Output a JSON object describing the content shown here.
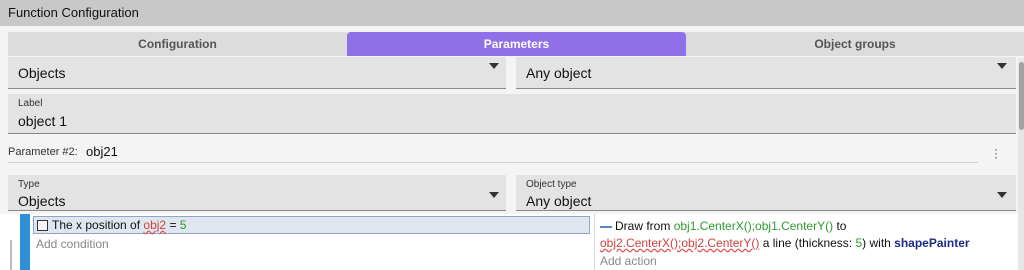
{
  "titlebar": {
    "title": "Function Configuration"
  },
  "tabs": [
    {
      "label": "Configuration"
    },
    {
      "label": "Parameters"
    },
    {
      "label": "Object groups"
    }
  ],
  "param1": {
    "type_value": "Objects",
    "object_type_value": "Any object",
    "label_caption": "Label",
    "label_value": "object 1"
  },
  "param2": {
    "caption": "Parameter #2:",
    "name": "obj21",
    "type_caption": "Type",
    "type_value": "Objects",
    "object_type_caption": "Object type",
    "object_type_value": "Any object"
  },
  "event": {
    "condition": {
      "prefix": "The x position of",
      "object": "obj2",
      "op": "=",
      "value": "5"
    },
    "add_condition": "Add condition",
    "action": {
      "prefix": "Draw from",
      "from": "obj1.CenterX();obj1.CenterY()",
      "to_word": "to",
      "to": "obj2.CenterX();obj2.CenterY()",
      "middle": "a line (thickness:",
      "thickness": "5",
      "with_word": ") with",
      "object": "shapePainter"
    },
    "add_action": "Add action"
  },
  "colors": {
    "accent": "#8f70e8",
    "event_bar": "#2f8fd6"
  }
}
